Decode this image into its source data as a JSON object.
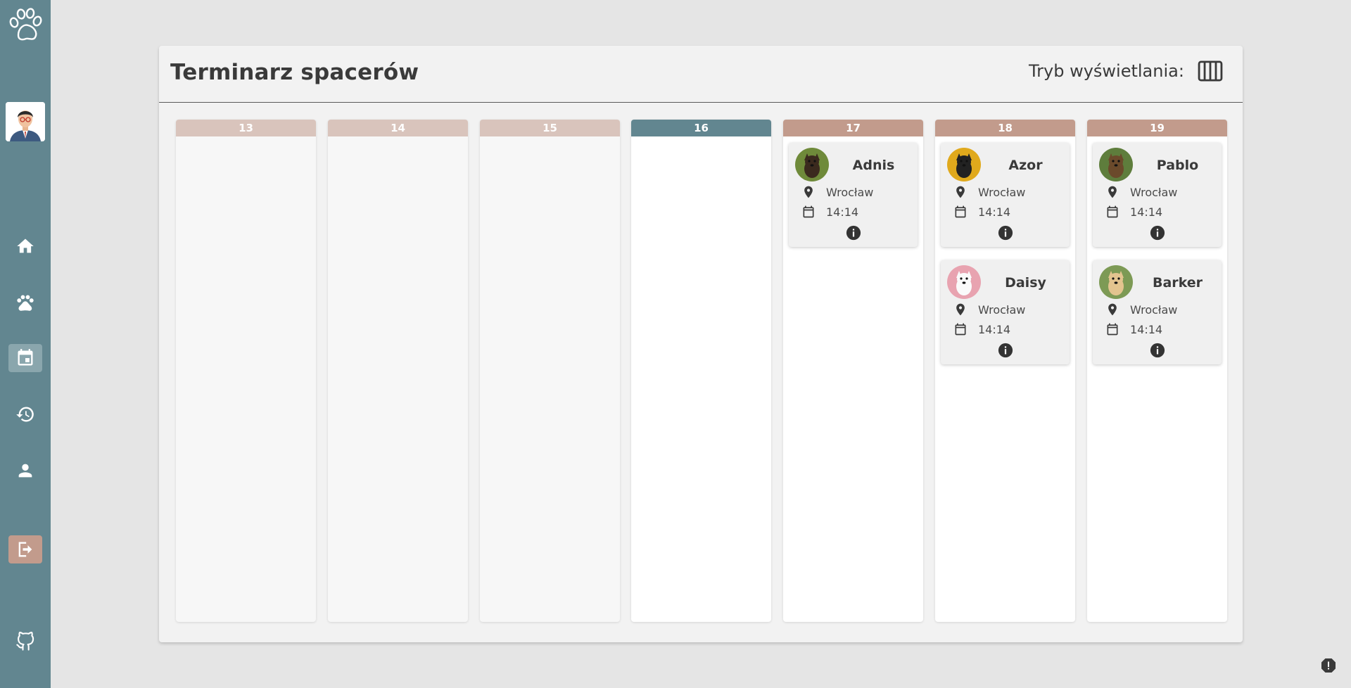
{
  "sidebar": {
    "logo_icon": "paw-prints-logo-icon",
    "nav": [
      {
        "name": "home",
        "icon": "home-icon"
      },
      {
        "name": "pets",
        "icon": "paw-icon"
      },
      {
        "name": "calendar",
        "icon": "calendar-icon",
        "active": true
      },
      {
        "name": "history",
        "icon": "history-icon"
      },
      {
        "name": "profile",
        "icon": "person-icon"
      }
    ],
    "logout_icon": "logout-icon",
    "github_icon": "github-icon"
  },
  "header": {
    "title": "Terminarz spacerów",
    "mode_label": "Tryb wyświetlania:",
    "mode_icon": "view-columns-icon"
  },
  "days": [
    {
      "label": "13",
      "state": "past",
      "walks": []
    },
    {
      "label": "14",
      "state": "past",
      "walks": []
    },
    {
      "label": "15",
      "state": "past",
      "walks": []
    },
    {
      "label": "16",
      "state": "today",
      "walks": []
    },
    {
      "label": "17",
      "state": "upcoming",
      "walks": [
        {
          "name": "Adnis",
          "city": "Wrocław",
          "time": "14:14"
        }
      ]
    },
    {
      "label": "18",
      "state": "upcoming",
      "walks": [
        {
          "name": "Azor",
          "city": "Wrocław",
          "time": "14:14"
        },
        {
          "name": "Daisy",
          "city": "Wrocław",
          "time": "14:14"
        }
      ]
    },
    {
      "label": "19",
      "state": "upcoming",
      "walks": [
        {
          "name": "Pablo",
          "city": "Wrocław",
          "time": "14:14"
        },
        {
          "name": "Barker",
          "city": "Wrocław",
          "time": "14:14"
        }
      ]
    }
  ],
  "colors": {
    "sidebar": "#628690",
    "accent": "#c29b8c",
    "past_header": "#d9c4bc",
    "today_header": "#628690"
  }
}
